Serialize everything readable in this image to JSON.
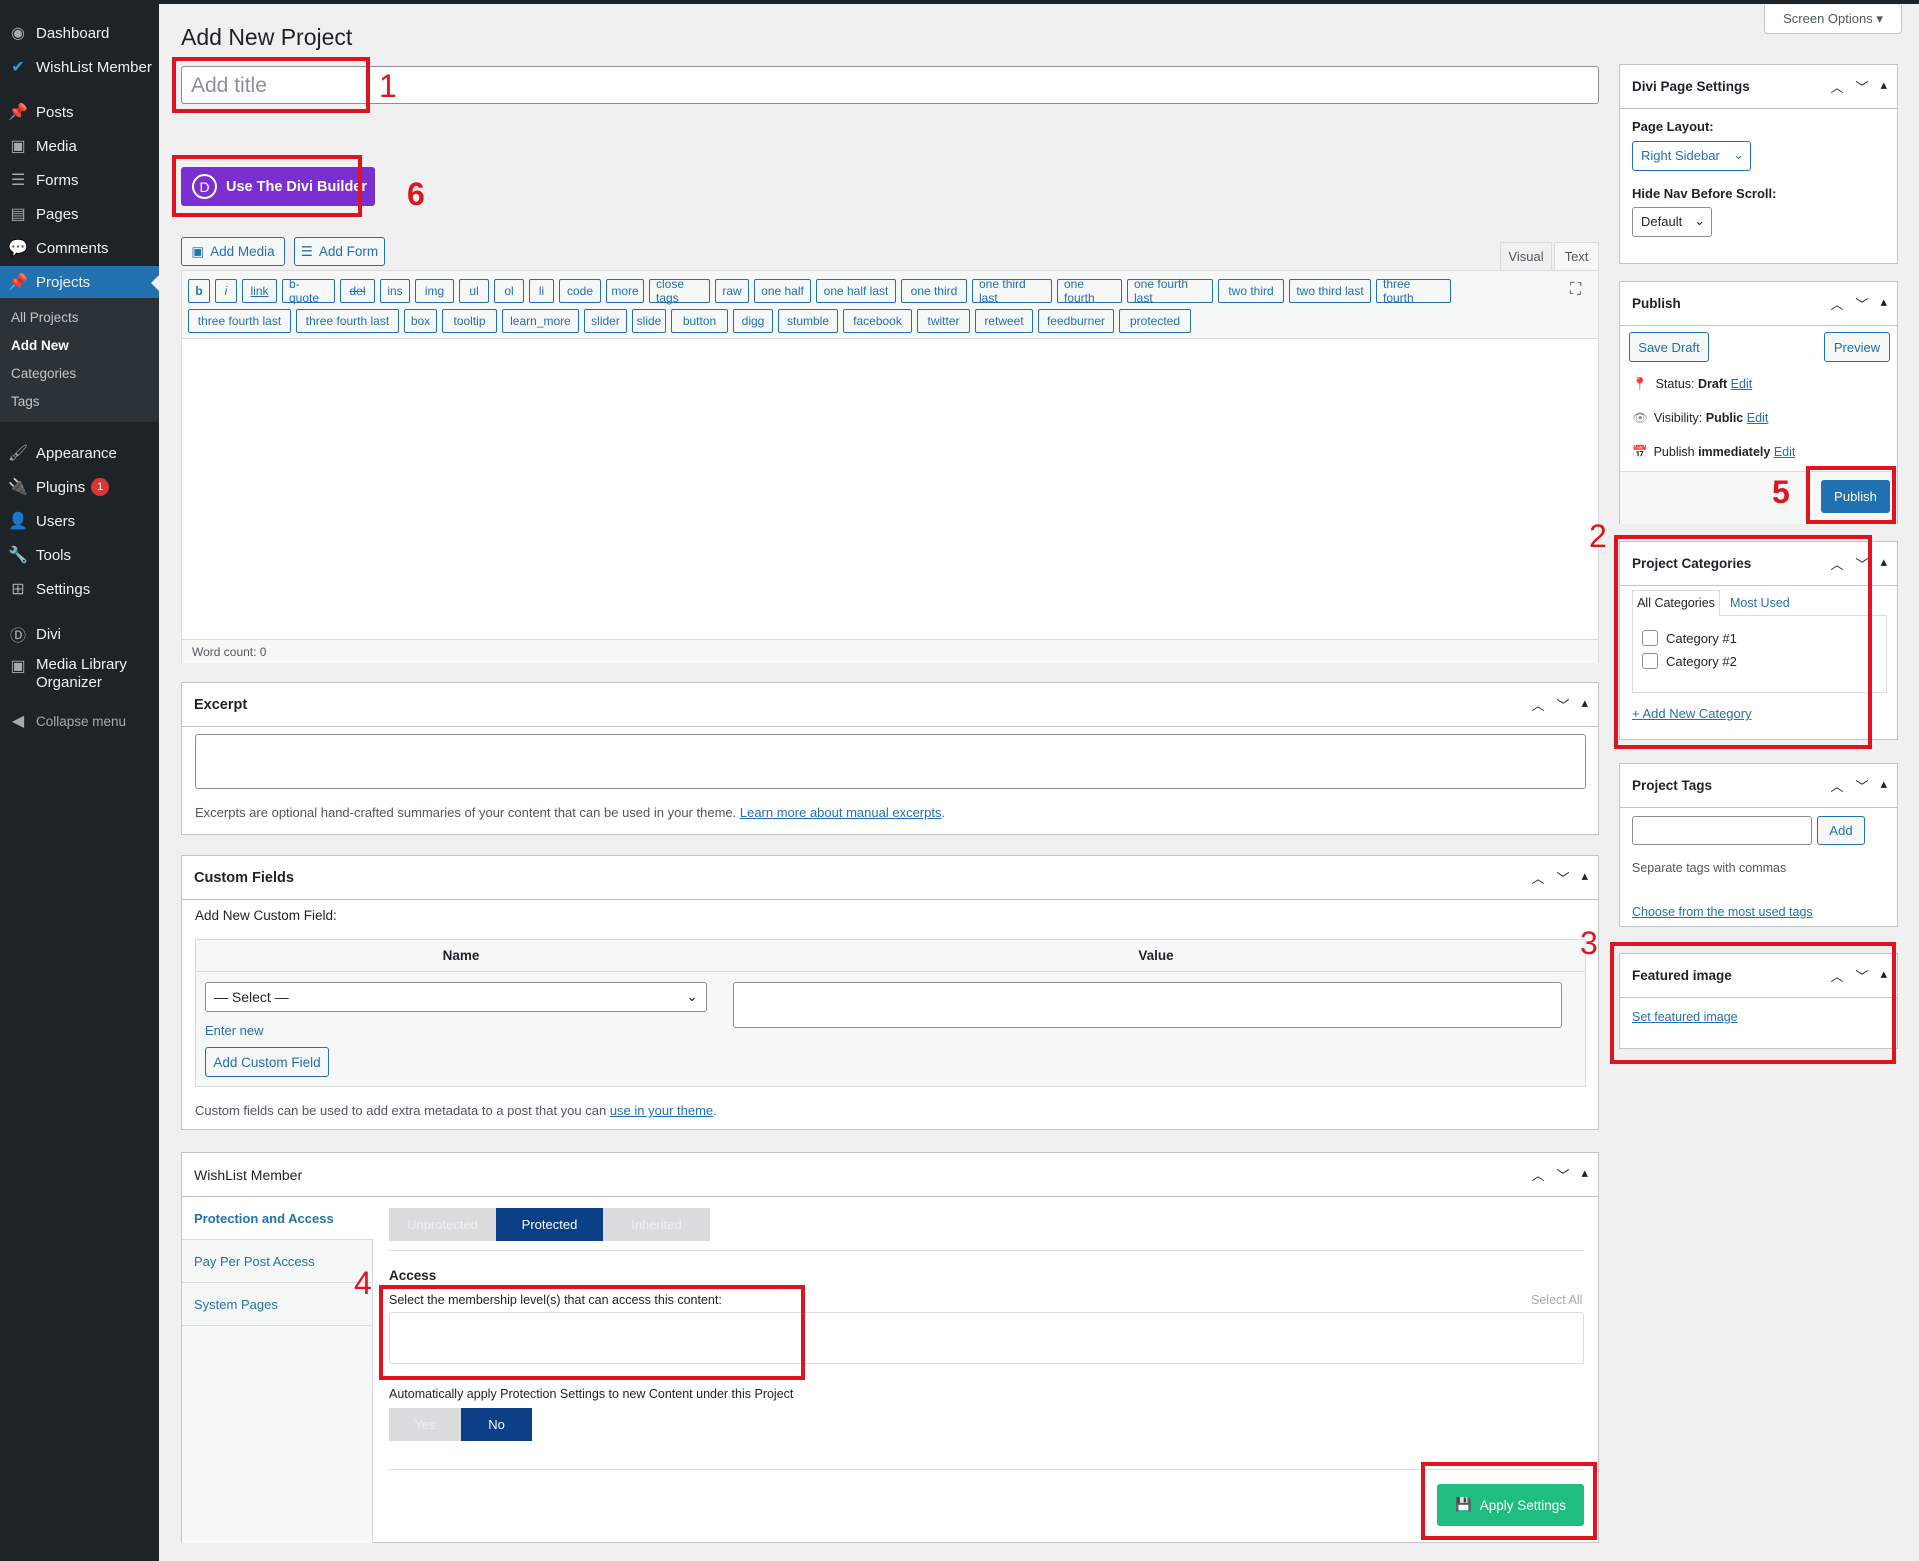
{
  "menu": {
    "dashboard": "Dashboard",
    "wishlist": "WishList Member",
    "posts": "Posts",
    "media": "Media",
    "forms": "Forms",
    "pages": "Pages",
    "comments": "Comments",
    "projects": "Projects",
    "projects_sub": [
      "All Projects",
      "Add New",
      "Categories",
      "Tags"
    ],
    "appearance": "Appearance",
    "plugins": "Plugins",
    "plugins_badge": "1",
    "users": "Users",
    "tools": "Tools",
    "settings": "Settings",
    "divi": "Divi",
    "mlo_line1": "Media Library",
    "mlo_line2": "Organizer",
    "collapse": "Collapse menu"
  },
  "screen_options": "Screen Options ▾",
  "page_title": "Add New Project",
  "title_placeholder": "Add title",
  "divi_button": "Use The Divi Builder",
  "add_media": "Add Media",
  "add_form": "Add Form",
  "editor_tabs": {
    "visual": "Visual",
    "text": "Text"
  },
  "quicktags_row1": [
    "b",
    "i",
    "link",
    "b-quote",
    "del",
    "ins",
    "img",
    "ul",
    "ol",
    "li",
    "code",
    "more",
    "close tags",
    "raw",
    "one half",
    "one half last",
    "one third",
    "one third last",
    "one fourth",
    "one fourth last",
    "two third",
    "two third last",
    "three fourth"
  ],
  "quicktags_row2": [
    "three fourth last",
    "three fourth last",
    "box",
    "tooltip",
    "learn_more",
    "slider",
    "slide",
    "button",
    "digg",
    "stumble",
    "facebook",
    "twitter",
    "retweet",
    "feedburner",
    "protected"
  ],
  "word_count": "Word count: 0",
  "excerpt": {
    "title": "Excerpt",
    "help": "Excerpts are optional hand-crafted summaries of your content that can be used in your theme. ",
    "help_link": "Learn more about manual excerpts",
    "help_end": "."
  },
  "custom_fields": {
    "title": "Custom Fields",
    "add_new": "Add New Custom Field:",
    "col_name": "Name",
    "col_value": "Value",
    "select": "— Select —",
    "enter_new": "Enter new",
    "add_button": "Add Custom Field",
    "help": "Custom fields can be used to add extra metadata to a post that you can ",
    "help_link": "use in your theme",
    "help_end": "."
  },
  "wishlist": {
    "title": "WishList Member",
    "tabs": [
      "Protection and Access",
      "Pay Per Post Access",
      "System Pages"
    ],
    "modes": [
      "Unprotected",
      "Protected",
      "Inherited"
    ],
    "access_label": "Access",
    "access_desc": "Select the membership level(s) that can access this content:",
    "select_all": "Select All",
    "auto_apply": "Automatically apply Protection Settings to new Content under this Project",
    "yes": "Yes",
    "no": "No",
    "apply": "Apply Settings"
  },
  "divi_settings": {
    "title": "Divi Page Settings",
    "layout_label": "Page Layout:",
    "layout_value": "Right Sidebar",
    "hidenav_label": "Hide Nav Before Scroll:",
    "hidenav_value": "Default"
  },
  "publish": {
    "title": "Publish",
    "save_draft": "Save Draft",
    "preview": "Preview",
    "status_label": "Status: ",
    "status_value": "Draft",
    "visibility_label": "Visibility: ",
    "visibility_value": "Public",
    "schedule": "Publish ",
    "schedule_value": "immediately",
    "edit": "Edit",
    "publish_button": "Publish"
  },
  "categories": {
    "title": "Project Categories",
    "tab_all": "All Categories",
    "tab_used": "Most Used",
    "items": [
      "Category #1",
      "Category #2"
    ],
    "add_new": "+ Add New Category"
  },
  "tags": {
    "title": "Project Tags",
    "add": "Add",
    "help": "Separate tags with commas",
    "choose": "Choose from the most used tags"
  },
  "featured": {
    "title": "Featured image",
    "set": "Set featured image"
  },
  "annotations": [
    "1",
    "2",
    "3",
    "4",
    "5",
    "6"
  ]
}
